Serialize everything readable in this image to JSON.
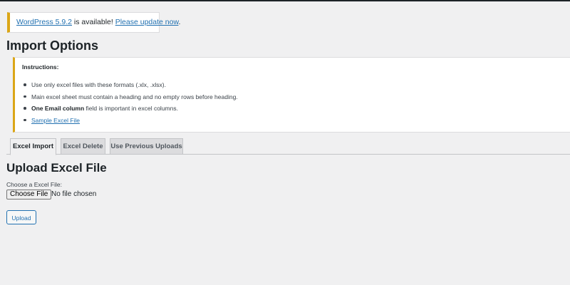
{
  "notice": {
    "version_link": "WordPress 5.9.2",
    "middle_text": " is available! ",
    "update_link": "Please update now",
    "end_text": "."
  },
  "page": {
    "title": "Import Options"
  },
  "instructions": {
    "heading": "Instructions:",
    "items": {
      "0": "Use only excel files with these formats (.xlx, .xlsx).",
      "1": "Main excel sheet must contain a heading and no empty rows before heading.",
      "2": {
        "bold": "One Email column",
        "rest": " field is important in excel columns."
      },
      "3": "Sample Excel File"
    }
  },
  "tabs": [
    {
      "label": "Excel Import",
      "active": true
    },
    {
      "label": "Excel Delete",
      "active": false
    },
    {
      "label": "Use Previous Uploads",
      "active": false
    }
  ],
  "upload": {
    "title": "Upload Excel File",
    "file_label": "Choose a Excel File:",
    "choose_button": "Choose File",
    "no_file_text": "No file chosen",
    "upload_button": "Upload"
  },
  "colors": {
    "notice_border": "#dba617",
    "link": "#2271b1",
    "background": "#f0f0f1"
  }
}
